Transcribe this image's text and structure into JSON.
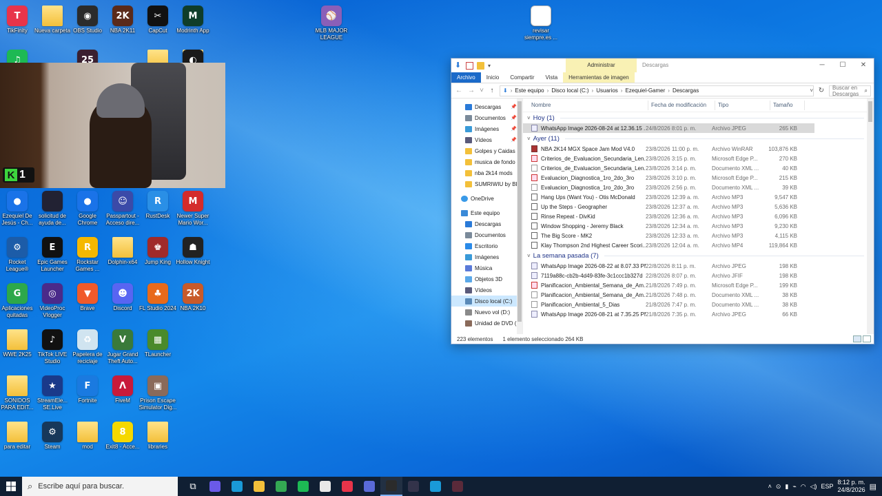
{
  "desktop": {
    "icons": [
      {
        "label": "TikFinity",
        "color": "#e8344a",
        "glyph": "T"
      },
      {
        "label": "Nueva carpeta",
        "color": "folder",
        "glyph": ""
      },
      {
        "label": "OBS Studio",
        "color": "#2b2b2b",
        "glyph": "◉"
      },
      {
        "label": "NBA 2K11",
        "color": "#5a2a1a",
        "glyph": "2K"
      },
      {
        "label": "CapCut",
        "color": "#111111",
        "glyph": "✂"
      },
      {
        "label": "Modrinth App",
        "color": "#0f3d2a",
        "glyph": "M"
      },
      {
        "label": "MLB MAJOR LEAGUE",
        "color": "#8a5fb8",
        "glyph": "⚾"
      },
      {
        "label": "revisar siempre.es ...",
        "color": "doc",
        "glyph": ""
      },
      {
        "label": "",
        "color": "#1db954",
        "glyph": "♫"
      },
      {
        "label": "",
        "color": "#3a2030",
        "glyph": "25"
      },
      {
        "label": "",
        "color": "folder",
        "glyph": ""
      },
      {
        "label": "",
        "color": "folder",
        "glyph": ""
      },
      {
        "label": "",
        "color": "#1a1a1a",
        "glyph": "◐"
      },
      {
        "label": "Ezequiel De Jesús - Ch...",
        "color": "#1a73e8",
        "glyph": "●"
      },
      {
        "label": "solicitud de ayuda de...",
        "color": "#223",
        "glyph": ""
      },
      {
        "label": "Google Chrome",
        "color": "#1a73e8",
        "glyph": "●"
      },
      {
        "label": "Passpartout - Acceso dire...",
        "color": "#3b4aa8",
        "glyph": "☺"
      },
      {
        "label": "RustDesk",
        "color": "#2a8fe6",
        "glyph": "R"
      },
      {
        "label": "Newer Super Mario Wor...",
        "color": "#d42b2b",
        "glyph": "M"
      },
      {
        "label": "Rocket League®",
        "color": "#1c5ca8",
        "glyph": "⚙"
      },
      {
        "label": "Epic Games Launcher",
        "color": "#111111",
        "glyph": "E"
      },
      {
        "label": "Rockstar Games ...",
        "color": "#f5b800",
        "glyph": "R"
      },
      {
        "label": "Dolphin-x64",
        "color": "folder",
        "glyph": ""
      },
      {
        "label": "Jump King",
        "color": "#a02a2a",
        "glyph": "♚"
      },
      {
        "label": "Hollow Knight",
        "color": "#222",
        "glyph": "☗"
      },
      {
        "label": "Aplicaciones quitadas",
        "color": "#2da84a",
        "glyph": "G"
      },
      {
        "label": "VideoProc Vlogger",
        "color": "#4a2a8a",
        "glyph": "◎"
      },
      {
        "label": "Brave",
        "color": "#f05a2a",
        "glyph": "▼"
      },
      {
        "label": "Discord",
        "color": "#5865f2",
        "glyph": "☻"
      },
      {
        "label": "FL Studio 2024",
        "color": "#e86a1a",
        "glyph": "♣"
      },
      {
        "label": "NBA 2K10",
        "color": "#c85a2a",
        "glyph": "2K"
      },
      {
        "label": "WWE 2K25",
        "color": "folder",
        "glyph": ""
      },
      {
        "label": "TikTok LIVE Studio",
        "color": "#111111",
        "glyph": "♪"
      },
      {
        "label": "Papelera de reciclaje",
        "color": "#d0e4f0",
        "glyph": "♻"
      },
      {
        "label": "Jugar Grand Theft Auto...",
        "color": "#3a7a3a",
        "glyph": "V"
      },
      {
        "label": "TLauncher",
        "color": "#4a8a2a",
        "glyph": "▦"
      },
      {
        "label": "SONIDOS PARA EDIT...",
        "color": "folder",
        "glyph": ""
      },
      {
        "label": "StreamEle... SE.Live",
        "color": "#1a3a8a",
        "glyph": "★"
      },
      {
        "label": "Fortnite",
        "color": "#1a7ae0",
        "glyph": "F"
      },
      {
        "label": "FiveM",
        "color": "#c81a3a",
        "glyph": "Λ"
      },
      {
        "label": "Prison Escape Simulator Dig...",
        "color": "#8a6a5a",
        "glyph": "▣"
      },
      {
        "label": "para editar",
        "color": "folder",
        "glyph": ""
      },
      {
        "label": "Steam",
        "color": "#17385a",
        "glyph": "⚙"
      },
      {
        "label": "mod",
        "color": "folder",
        "glyph": ""
      },
      {
        "label": "Exit8 - Acce...",
        "color": "#f5d800",
        "glyph": "8"
      },
      {
        "label": "libraries",
        "color": "folder",
        "glyph": ""
      }
    ],
    "webcam": {
      "badge_letter": "K",
      "badge_number": "1"
    }
  },
  "explorer": {
    "context_tab": "Administrar",
    "window_title": "Descargas",
    "ribbon_tabs": [
      "Archivo",
      "Inicio",
      "Compartir",
      "Vista",
      "Herramientas de imagen"
    ],
    "breadcrumb": [
      "Este equipo",
      "Disco local (C:)",
      "Usuarios",
      "Ezequiel-Gamer",
      "Descargas"
    ],
    "search_placeholder": "Buscar en Descargas",
    "columns": [
      "Nombre",
      "Fecha de modificación",
      "Tipo",
      "Tamaño"
    ],
    "nav_quick": [
      {
        "label": "Descargas",
        "pinned": true,
        "color": "#2a7ad8"
      },
      {
        "label": "Documentos",
        "pinned": true,
        "color": "#7a8a9a"
      },
      {
        "label": "Imágenes",
        "pinned": true,
        "color": "#3a9ad8"
      },
      {
        "label": "Vídeos",
        "pinned": true,
        "color": "#5a5a7a"
      },
      {
        "label": "Golpes y Caidas",
        "pinned": false,
        "color": "#f3c03a"
      },
      {
        "label": "musica de fondo",
        "pinned": false,
        "color": "#f3c03a"
      },
      {
        "label": "nba 2k14 mods",
        "pinned": false,
        "color": "#f3c03a"
      },
      {
        "label": "SUMRIWIU by BL",
        "pinned": false,
        "color": "#f3c03a"
      }
    ],
    "nav_onedrive": "OneDrive",
    "nav_pc": "Este equipo",
    "nav_pc_items": [
      {
        "label": "Descargas",
        "color": "#2a7ad8"
      },
      {
        "label": "Documentos",
        "color": "#7a8a9a"
      },
      {
        "label": "Escritorio",
        "color": "#2a8ae8"
      },
      {
        "label": "Imágenes",
        "color": "#3a9ad8"
      },
      {
        "label": "Música",
        "color": "#5a7ad8"
      },
      {
        "label": "Objetos 3D",
        "color": "#5aa8e8"
      },
      {
        "label": "Vídeos",
        "color": "#5a5a7a"
      },
      {
        "label": "Disco local (C:)",
        "color": "#5a8ab8",
        "selected": true
      },
      {
        "label": "Nuevo vol (D:)",
        "color": "#8a8a8a"
      },
      {
        "label": "Unidad de DVD (",
        "color": "#8a6a5a"
      }
    ],
    "groups": [
      {
        "title": "Hoy (1)",
        "rows": [
          {
            "name": "WhatsApp Image 2026-08-24 at 12.36.15 ...",
            "date": "24/8/2026 8:01 p. m.",
            "type": "Archivo JPEG",
            "size": "265 KB",
            "selected": true
          }
        ]
      },
      {
        "title": "Ayer (11)",
        "rows": [
          {
            "name": "NBA 2K14 MGX Space Jam Mod V4.0",
            "date": "23/8/2026 11:00 p. m.",
            "type": "Archivo WinRAR",
            "size": "103,876 KB"
          },
          {
            "name": "Criterios_de_Evaluacion_Secundaria_Len...",
            "date": "23/8/2026 3:15 p. m.",
            "type": "Microsoft Edge P...",
            "size": "270 KB"
          },
          {
            "name": "Criterios_de_Evaluacion_Secundaria_Len...",
            "date": "23/8/2026 3:14 p. m.",
            "type": "Documento XML ...",
            "size": "40 KB"
          },
          {
            "name": "Evaluacion_Diagnostica_1ro_2do_3ro",
            "date": "23/8/2026 3:10 p. m.",
            "type": "Microsoft Edge P...",
            "size": "215 KB"
          },
          {
            "name": "Evaluacion_Diagnostica_1ro_2do_3ro",
            "date": "23/8/2026 2:56 p. m.",
            "type": "Documento XML ...",
            "size": "39 KB"
          },
          {
            "name": "Hang Ups (Want You) - Otis McDonald",
            "date": "23/8/2026 12:39 a. m.",
            "type": "Archivo MP3",
            "size": "9,547 KB"
          },
          {
            "name": "Up the Steps - Geographer",
            "date": "23/8/2026 12:37 a. m.",
            "type": "Archivo MP3",
            "size": "5,636 KB"
          },
          {
            "name": "Rinse Repeat - DivKid",
            "date": "23/8/2026 12:36 a. m.",
            "type": "Archivo MP3",
            "size": "6,096 KB"
          },
          {
            "name": "Window Shopping - Jeremy Black",
            "date": "23/8/2026 12:34 a. m.",
            "type": "Archivo MP3",
            "size": "9,230 KB"
          },
          {
            "name": "The Big Score - MK2",
            "date": "23/8/2026 12:33 a. m.",
            "type": "Archivo MP3",
            "size": "4,115 KB"
          },
          {
            "name": "Klay Thompson 2nd Highest Career Scori...",
            "date": "23/8/2026 12:04 a. m.",
            "type": "Archivo MP4",
            "size": "119,864 KB"
          }
        ]
      },
      {
        "title": "La semana pasada (7)",
        "rows": [
          {
            "name": "WhatsApp Image 2026-08-22 at 8.07.33 PM",
            "date": "22/8/2026 8:11 p. m.",
            "type": "Archivo JPEG",
            "size": "198 KB"
          },
          {
            "name": "7119a88c-cb2b-4d49-83fe-3c1ccc1b327d",
            "date": "22/8/2026 8:07 p. m.",
            "type": "Archivo JFIF",
            "size": "198 KB"
          },
          {
            "name": "Planificacion_Ambiental_Semana_de_Am...",
            "date": "21/8/2026 7:49 p. m.",
            "type": "Microsoft Edge P...",
            "size": "199 KB"
          },
          {
            "name": "Planificacion_Ambiental_Semana_de_Am...",
            "date": "21/8/2026 7:48 p. m.",
            "type": "Documento XML ...",
            "size": "38 KB"
          },
          {
            "name": "Planificacion_Ambiental_5_Dias",
            "date": "21/8/2026 7:47 p. m.",
            "type": "Documento XML ...",
            "size": "38 KB"
          },
          {
            "name": "WhatsApp Image 2026-08-21 at 7.35.25 PM",
            "date": "21/8/2026 7:35 p. m.",
            "type": "Archivo JPEG",
            "size": "66 KB"
          }
        ]
      }
    ],
    "status_count": "223 elementos",
    "status_selected": "1 elemento seleccionado  264 KB"
  },
  "taskbar": {
    "search_placeholder": "Escribe aquí para buscar.",
    "apps": [
      {
        "name": "task-view",
        "color": "#ffffff00",
        "glyph": "⧉"
      },
      {
        "name": "copilot",
        "color": "#6a5ae8"
      },
      {
        "name": "edge",
        "color": "#1a9ad8"
      },
      {
        "name": "file-explorer",
        "color": "#f3c03a"
      },
      {
        "name": "chrome",
        "color": "#34a853"
      },
      {
        "name": "spotify",
        "color": "#1db954"
      },
      {
        "name": "notepad",
        "color": "#e8e8e8"
      },
      {
        "name": "tikfinity",
        "color": "#e8344a"
      },
      {
        "name": "app-diamond",
        "color": "#5a6ad8"
      },
      {
        "name": "obs",
        "color": "#2b2b2b",
        "active": true
      },
      {
        "name": "audio-app",
        "color": "#33334a"
      },
      {
        "name": "dolphin",
        "color": "#1a9ad8"
      },
      {
        "name": "nba-game",
        "color": "#5a2a3a"
      }
    ],
    "language": "ESP",
    "time": "8:12 p. m.",
    "date": "24/8/2026"
  }
}
